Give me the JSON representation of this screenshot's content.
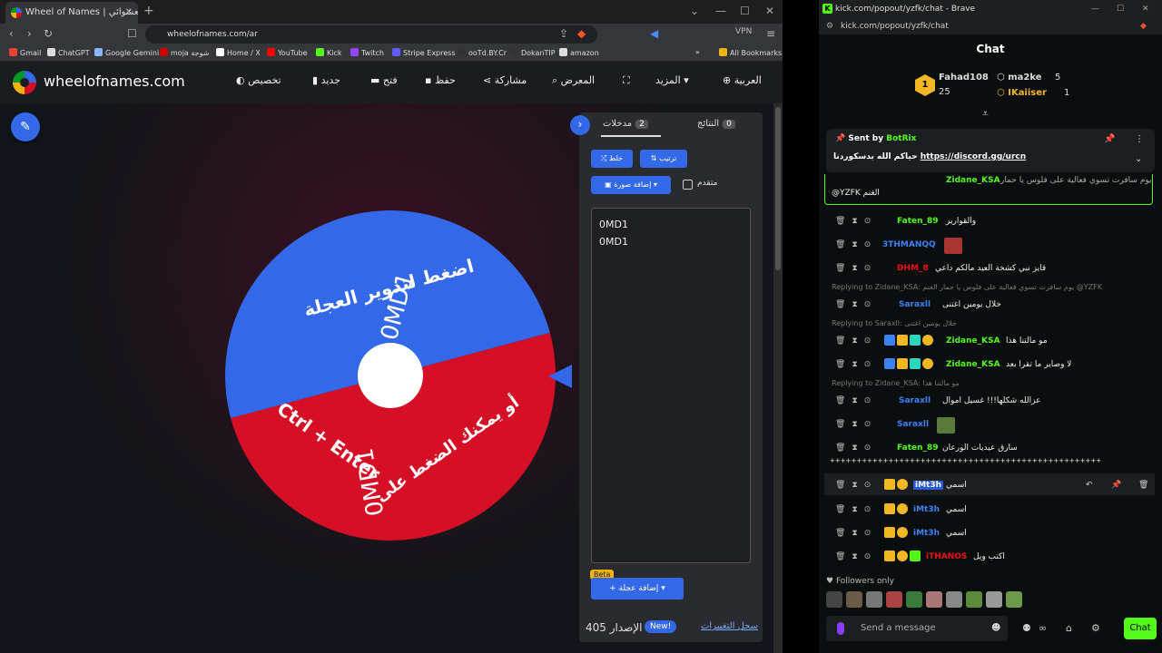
{
  "left_browser": {
    "tab_title": "Wheel of Names | أداة الاسم العشوائي",
    "address": "wheelofnames.com/ar",
    "vpn_label": "VPN",
    "bookmarks": [
      "Gmail",
      "ChatGPT",
      "Google Gemini",
      "moja شوجة",
      "Home / X",
      "YouTube",
      "Kick",
      "Twitch",
      "Stripe Express",
      "ooTd.BY.Cr",
      "DokanTIP",
      "amazon"
    ],
    "all_bookmarks": "All Bookmarks"
  },
  "site": {
    "logo": "wheelofnames.com",
    "menu": {
      "customize": "تخصيص",
      "new": "جديد",
      "open": "فتح",
      "save": "حفظ",
      "share": "مشاركة",
      "gallery": "المعرض",
      "more": "المزيد",
      "language": "العربية"
    },
    "wheel": {
      "blue_label": "اضغط لتدوير العجلة",
      "red_label": "أو يمكنك الضغط على",
      "shortcut": "Ctrl + Enter",
      "entry_text": "0MD1",
      "colors": {
        "blue": "#3369e8",
        "red": "#d50f25"
      }
    },
    "panel": {
      "tab_entries": "مدخلات",
      "entries_count": "2",
      "tab_results": "النتائج",
      "results_count": "0",
      "shuffle": "خلط",
      "sort": "ترتيب",
      "add_image": "إضافة صورة",
      "advanced": "متقدم",
      "entries": [
        "0MD1",
        "0MD1"
      ],
      "beta": "Beta",
      "add_wheel": "إضافة عجلة",
      "version": "الإصدار 405",
      "new_badge": "New!",
      "changelog": "سجل التغييرات"
    }
  },
  "right_browser": {
    "title": "kick.com/popout/yzfk/chat - Brave",
    "url": "kick.com/popout/yzfk/chat",
    "chat_header": "Chat",
    "leaderboard": [
      {
        "rank": "1",
        "name": "Fahad108",
        "value": "25"
      },
      {
        "name": "ma2ke",
        "value": "5"
      },
      {
        "name": "IKaiiser",
        "value": "1"
      }
    ],
    "pinned": {
      "sent_by": "Sent by",
      "bot": "BotRix",
      "message": "حياكم الله بدسكوردنا",
      "link": "https://discord.gg/urcn"
    },
    "messages": [
      {
        "user": "Zidane_KSA",
        "text": "يوم سافرت تسوي فعالية على فلوس يا حمار",
        "extra": "@YZFK الغنم"
      },
      {
        "user": "Faten_89",
        "text": "والقوارير"
      },
      {
        "user": "3THMANQQ",
        "text": ""
      },
      {
        "user": "DHM_8",
        "text": "قايز نبي كشخة العيد مالكم داعي"
      },
      {
        "reply": "Replying to Zidane_KSA: يوم سافرت تسوي فعالية على فلوس يا حمار الغنم @YZFK"
      },
      {
        "user": "Saraxll",
        "text": "خلال يومين اغتنى"
      },
      {
        "reply": "Replying to Saraxll: خلال يومين اغتنى"
      },
      {
        "user": "Zidane_KSA",
        "text": "مو مالتنا هذا"
      },
      {
        "user": "Zidane_KSA",
        "text": "لا وصاير ما تقرا بعد"
      },
      {
        "reply": "Replying to Zidane_KSA: مو مالتنا هذا"
      },
      {
        "user": "Saraxll",
        "text": "عزالله شكلها!!! غسيل اموال"
      },
      {
        "user": "Saraxll",
        "text": ""
      },
      {
        "user": "Faten_89",
        "text": "سارق عيديات الورعان"
      },
      {
        "text": "+++++++++++++++++++++++++++++++++++++++++++++++++++"
      },
      {
        "user": "iMt3h",
        "text": "اسمي"
      },
      {
        "user": "iMt3h",
        "text": "اسمي"
      },
      {
        "user": "iMt3h",
        "text": "اسمي"
      },
      {
        "user": "iTHANOS",
        "text": "اكتب ويل"
      }
    ],
    "followers_only": "Followers only",
    "send_placeholder": "Send a message",
    "chat_button": "Chat"
  }
}
